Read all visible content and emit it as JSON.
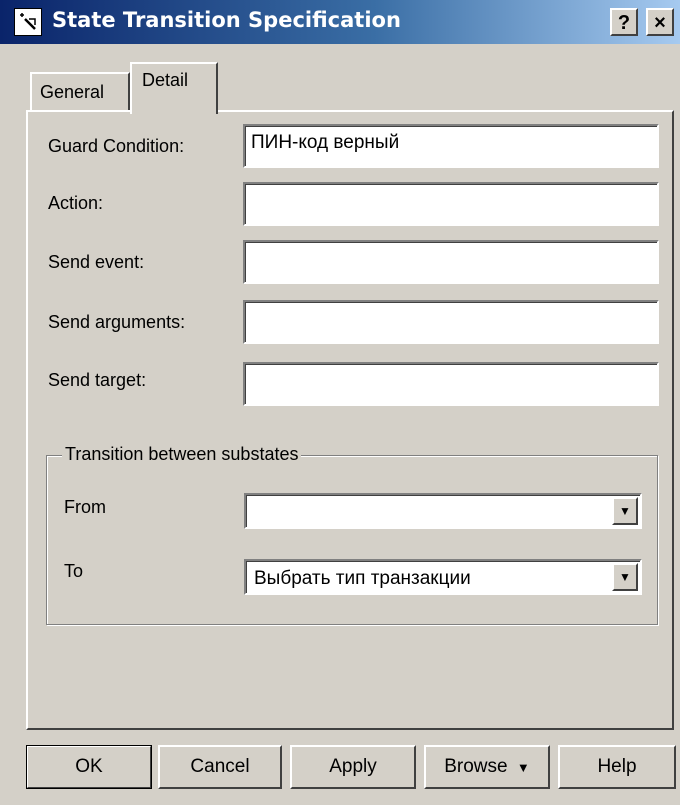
{
  "window": {
    "title": "State Transition Specification",
    "help_button": "?",
    "close_button": "×"
  },
  "tabs": [
    {
      "label": "General",
      "active": false
    },
    {
      "label": "Detail",
      "active": true
    }
  ],
  "fields": {
    "guard_condition": {
      "label": "Guard Condition:",
      "value": "ПИН-код верный"
    },
    "action": {
      "label": "Action:",
      "value": ""
    },
    "send_event": {
      "label": "Send event:",
      "value": ""
    },
    "send_arguments": {
      "label": "Send arguments:",
      "value": ""
    },
    "send_target": {
      "label": "Send target:",
      "value": ""
    }
  },
  "substates": {
    "legend": "Transition between substates",
    "from": {
      "label": "From",
      "value": ""
    },
    "to": {
      "label": "To",
      "value": "Выбрать тип транзакции"
    }
  },
  "buttons": {
    "ok": "OK",
    "cancel": "Cancel",
    "apply": "Apply",
    "browse": "Browse",
    "help": "Help"
  }
}
